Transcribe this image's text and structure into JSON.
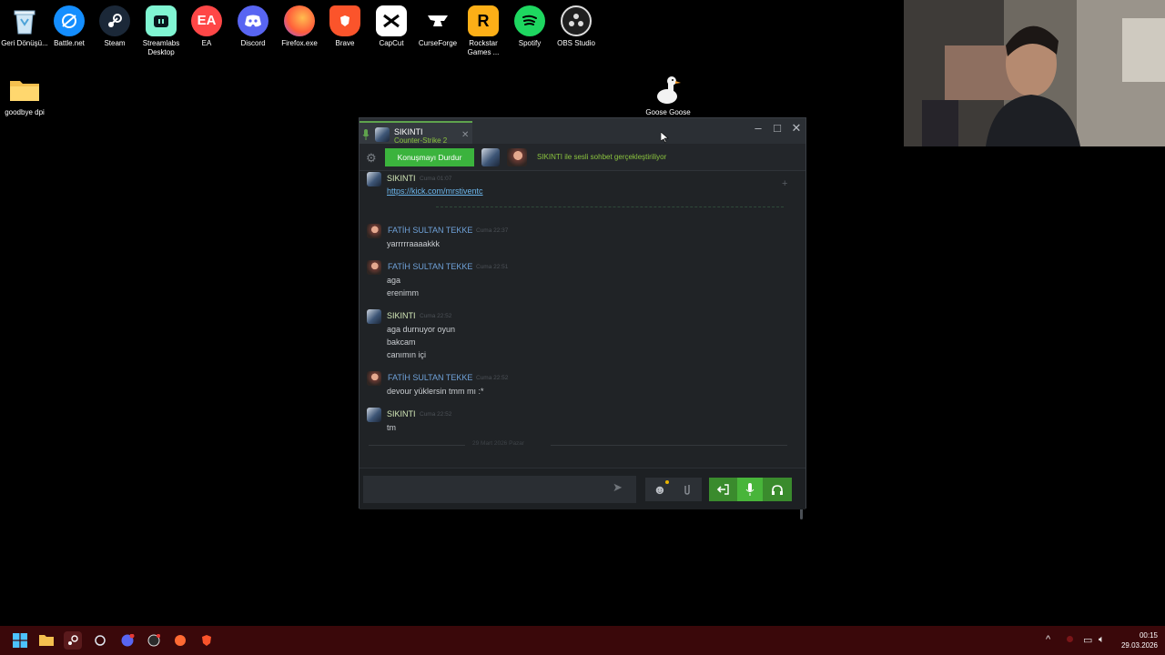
{
  "desktop": {
    "icons": [
      {
        "label": "Geri Dönüşü...",
        "icon": "recycle-bin-icon"
      },
      {
        "label": "Battle.net",
        "icon": "battlenet-icon"
      },
      {
        "label": "Steam",
        "icon": "steam-icon"
      },
      {
        "label": "Streamlabs Desktop",
        "icon": "streamlabs-icon"
      },
      {
        "label": "EA",
        "icon": "ea-icon",
        "glyph": "EA"
      },
      {
        "label": "Discord",
        "icon": "discord-icon"
      },
      {
        "label": "Firefox.exe",
        "icon": "firefox-icon"
      },
      {
        "label": "Brave",
        "icon": "brave-icon"
      },
      {
        "label": "CapCut",
        "icon": "capcut-icon"
      },
      {
        "label": "CurseForge",
        "icon": "curseforge-icon"
      },
      {
        "label": "Rockstar Games ...",
        "icon": "rockstar-icon",
        "glyph": "R"
      },
      {
        "label": "Spotify",
        "icon": "spotify-icon"
      },
      {
        "label": "OBS Studio",
        "icon": "obs-icon"
      }
    ],
    "folder_label": "goodbye dpi",
    "goose_label": "Goose Goose"
  },
  "chat": {
    "tab_name": "SIKINTI",
    "tab_game": "Counter-Strike 2",
    "stop_button": "Konuşmayı Durdur",
    "voice_status": "SIKINTI ile sesli sohbet gerçekleştiriliyor",
    "link": "https://kick.com/mrstiventc",
    "messages": [
      {
        "name": "SIKINTI",
        "time": "Cuma 01:07"
      },
      {
        "name": "FATİH SULTAN TEKKE",
        "time": "Cuma 22:37",
        "lines": [
          "yarrrrraaaakkk"
        ]
      },
      {
        "name": "FATİH SULTAN TEKKE",
        "time": "Cuma 22:51",
        "lines": [
          "aga",
          "erenimm"
        ]
      },
      {
        "name": "SIKINTI",
        "time": "Cuma 22:52",
        "lines": [
          "aga durnuyor oyun",
          "bakcam",
          "canımın içi"
        ]
      },
      {
        "name": "FATİH SULTAN TEKKE",
        "time": "Cuma 22:52",
        "lines": [
          "devour yüklersin tmm mı :*"
        ]
      },
      {
        "name": "SIKINTI",
        "time": "Cuma 22:52",
        "lines": [
          "tm"
        ]
      }
    ],
    "date_separator": "29 Mart 2026 Pazar",
    "input_placeholder": ""
  },
  "taskbar": {
    "time": "00:15",
    "date": "29.03.2026"
  },
  "colors": {
    "taskbar": "#3a080a",
    "voice_green": "#3bb33d",
    "link_blue": "#6bb5ea",
    "friend_name": "#6fa2d9"
  }
}
